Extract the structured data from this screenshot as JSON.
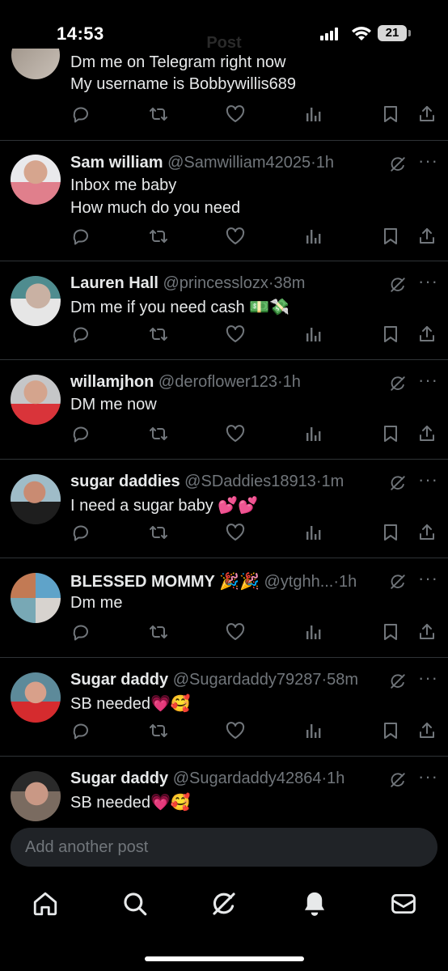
{
  "status_bar": {
    "time": "14:53",
    "battery": "21"
  },
  "header": {
    "title": "Post"
  },
  "partial_post": {
    "line_cut": "Dm me on Telegram right now",
    "line2": "My username is Bobbywillis689"
  },
  "posts": [
    {
      "name": "Sam william",
      "handle": "@Samwilliam42025",
      "time": "1h",
      "lines": [
        "Inbox me baby",
        "How much do you need"
      ]
    },
    {
      "name": "Lauren Hall",
      "handle": "@princesslozx",
      "time": "38m",
      "lines": [
        "Dm me if you need cash 💵💸"
      ]
    },
    {
      "name": "willamjhon",
      "handle": "@deroflower123",
      "time": "1h",
      "lines": [
        "DM me now"
      ]
    },
    {
      "name": "sugar daddies",
      "handle": "@SDaddies18913",
      "time": "1m",
      "lines": [
        "I need a sugar baby 💕💕"
      ]
    },
    {
      "name": "BLESSED MOMMY 🎉🎉",
      "handle": "@ytghh...",
      "time": "1h",
      "lines": [
        "Dm me"
      ]
    },
    {
      "name": "Sugar daddy",
      "handle": "@Sugardaddy79287",
      "time": "58m",
      "lines": [
        "SB needed💗🥰"
      ]
    },
    {
      "name": "Sugar daddy",
      "handle": "@Sugardaddy42864",
      "time": "1h",
      "lines": [
        "SB needed💗🥰"
      ]
    }
  ],
  "composer": {
    "placeholder": "Add another post"
  },
  "colors": {
    "background": "#000000",
    "text": "#e7e9ea",
    "muted": "#71767b",
    "divider": "#2f3336",
    "composer": "#202327"
  },
  "icons": {
    "post_actions": [
      "reply-icon",
      "repost-icon",
      "like-icon",
      "views-icon",
      "bookmark-icon",
      "share-icon"
    ],
    "bottom_nav": [
      "home-icon",
      "search-icon",
      "grok-icon",
      "notifications-icon",
      "messages-icon"
    ]
  }
}
